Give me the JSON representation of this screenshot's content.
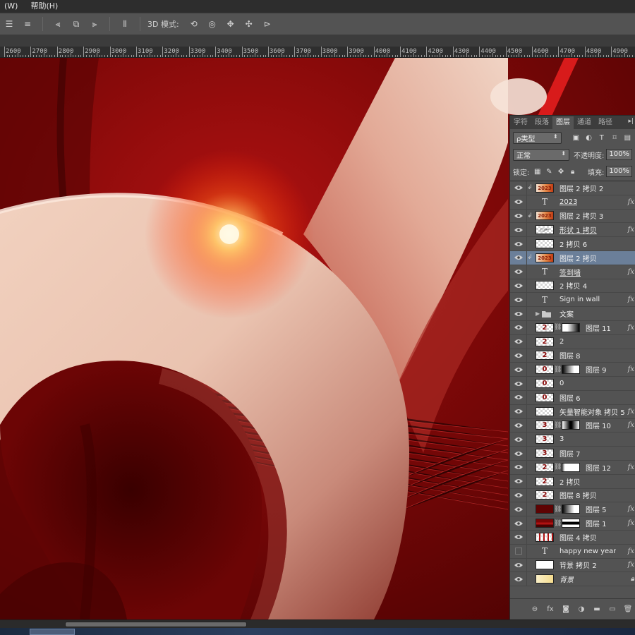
{
  "menubar": {
    "items": [
      "(W)",
      "帮助(H)"
    ]
  },
  "options_bar": {
    "mode_label": "3D 模式:",
    "align_icons": [
      "align-top-icon",
      "align-vcenter-icon",
      "align-left-icon",
      "align-hcenter-icon",
      "align-right-icon",
      "distribute-icon"
    ],
    "mode_icons": [
      "rotate-3d-icon",
      "roll-3d-icon",
      "pan-3d-icon",
      "slide-3d-icon",
      "scale-3d-icon"
    ]
  },
  "ruler": {
    "labels": [
      "2600",
      "2700",
      "2800",
      "2900",
      "3000",
      "3100",
      "3200",
      "3300",
      "3400",
      "3500",
      "3600",
      "3700",
      "3800",
      "3900",
      "4000",
      "4100",
      "4200",
      "4300",
      "4400",
      "4500",
      "4600",
      "4700",
      "4800",
      "4900"
    ]
  },
  "colors": {
    "canvas_red": "#7a0606",
    "accent_red": "#c41616",
    "selection_blue": "#6b7f99",
    "glow": "#ffd08a"
  },
  "panel": {
    "tabs": [
      "字符",
      "段落",
      "图层",
      "通道",
      "路径"
    ],
    "active_tab": "图层",
    "filter_label": "ρ类型",
    "blend_mode": "正常",
    "opacity_label": "不透明度:",
    "opacity_value": "100%",
    "lock_label": "锁定:",
    "fill_label": "填充:",
    "fill_value": "100%"
  },
  "layers": [
    {
      "name": "图层 2 拷贝 2",
      "kind": "image",
      "clip": true,
      "visible": true
    },
    {
      "name": "2023",
      "kind": "text",
      "visible": true,
      "fx": true,
      "ul": true
    },
    {
      "name": "图层 2 拷贝 3",
      "kind": "image",
      "clip": true,
      "visible": true
    },
    {
      "name": "形状 1 拷贝",
      "kind": "shape",
      "visible": true,
      "fx": true,
      "ul": true
    },
    {
      "name": "2 拷贝 6",
      "kind": "empty",
      "visible": true
    },
    {
      "name": "图层 2 拷贝",
      "kind": "image",
      "clip": true,
      "visible": true,
      "selected": true
    },
    {
      "name": "签到墙",
      "kind": "text",
      "visible": true,
      "fx": true,
      "ul": true
    },
    {
      "name": "2 拷贝 4",
      "kind": "empty",
      "visible": true
    },
    {
      "name": "Sign in wall",
      "kind": "text",
      "visible": true,
      "fx": true
    },
    {
      "name": "文案",
      "kind": "folder",
      "visible": true
    },
    {
      "name": "图层 11",
      "kind": "masked",
      "glyph": "2",
      "mask": "rgrad",
      "visible": true,
      "fx": true
    },
    {
      "name": "2",
      "kind": "glyph",
      "glyph": "2",
      "visible": true
    },
    {
      "name": "图层 8",
      "kind": "glyph",
      "glyph": "2",
      "visible": true
    },
    {
      "name": "图层 9",
      "kind": "masked",
      "glyph": "0",
      "mask": "lgrad",
      "visible": true,
      "fx": true
    },
    {
      "name": "0",
      "kind": "glyph",
      "glyph": "0",
      "visible": true
    },
    {
      "name": "图层 6",
      "kind": "glyph",
      "glyph": "0",
      "visible": true
    },
    {
      "name": "矢量智能对象 拷贝 5",
      "kind": "empty",
      "visible": true,
      "fx": true
    },
    {
      "name": "图层 10",
      "kind": "masked",
      "glyph": "3",
      "mask": "center",
      "visible": true,
      "fx": true
    },
    {
      "name": "3",
      "kind": "glyph",
      "glyph": "3",
      "visible": true
    },
    {
      "name": "图层 7",
      "kind": "glyph",
      "glyph": "3",
      "visible": true
    },
    {
      "name": "图层 12",
      "kind": "masked",
      "glyph": "2",
      "mask": "white",
      "visible": true,
      "fx": true
    },
    {
      "name": "2 拷贝",
      "kind": "glyph",
      "glyph": "2",
      "visible": true
    },
    {
      "name": "图层 8 拷贝",
      "kind": "glyph",
      "glyph": "2",
      "visible": true
    },
    {
      "name": "图层 5",
      "kind": "dark",
      "mask": "lgrad",
      "visible": true,
      "fx": true
    },
    {
      "name": "图层 1",
      "kind": "dark2",
      "mask": "bar",
      "visible": true,
      "fx": true
    },
    {
      "name": "图层 4 拷贝",
      "kind": "redfill",
      "visible": true
    },
    {
      "name": "happy new year",
      "kind": "text",
      "visible": false,
      "fx": true
    },
    {
      "name": "背景 拷贝 2",
      "kind": "white",
      "visible": true,
      "fx": true
    },
    {
      "name": "背景",
      "kind": "bg",
      "visible": true,
      "it": true,
      "locked": true
    }
  ],
  "panel_footer": {
    "icons": [
      "link-layers-icon",
      "fx-icon",
      "add-mask-icon",
      "adjustment-icon",
      "new-group-icon",
      "new-layer-icon",
      "delete-layer-icon"
    ]
  }
}
